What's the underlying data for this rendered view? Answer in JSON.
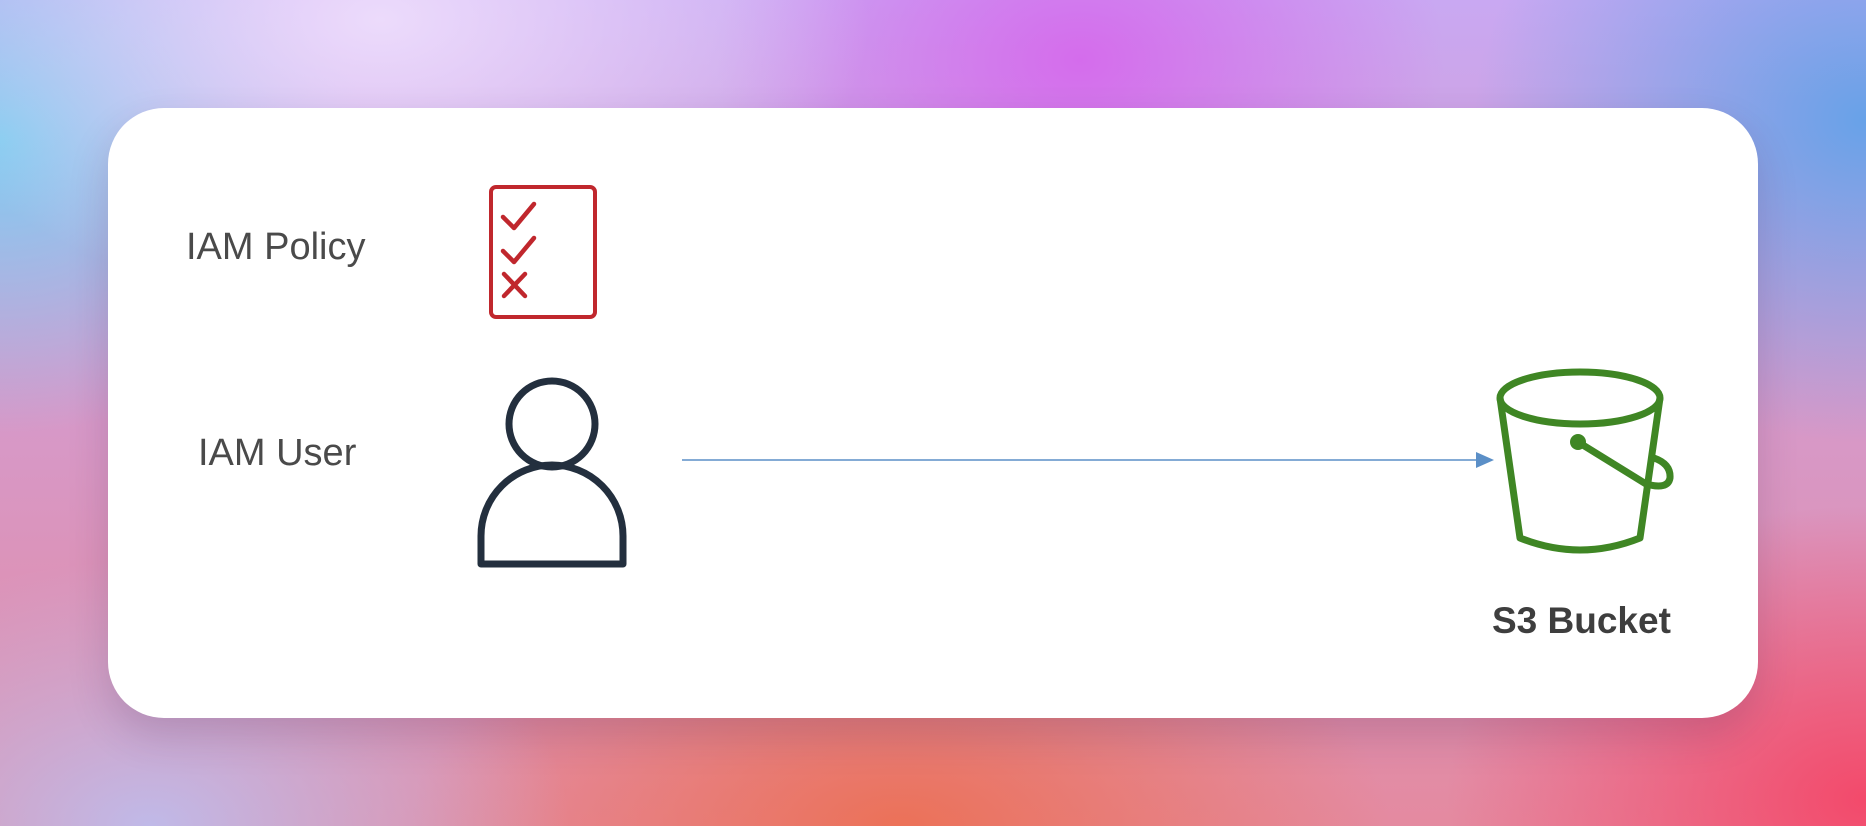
{
  "diagram": {
    "nodes": [
      {
        "id": "iam-policy",
        "label": "IAM Policy",
        "icon": "policy-checklist-icon"
      },
      {
        "id": "iam-user",
        "label": "IAM User",
        "icon": "user-icon"
      },
      {
        "id": "s3-bucket",
        "label": "S3 Bucket",
        "icon": "bucket-icon"
      }
    ],
    "edges": [
      {
        "from": "iam-user",
        "to": "s3-bucket",
        "style": "arrow"
      }
    ]
  },
  "colors": {
    "policy_icon": "#c0272d",
    "user_icon": "#232f3e",
    "bucket_icon": "#3f8624",
    "arrow": "#5b8fc7",
    "card_background": "#ffffff"
  }
}
